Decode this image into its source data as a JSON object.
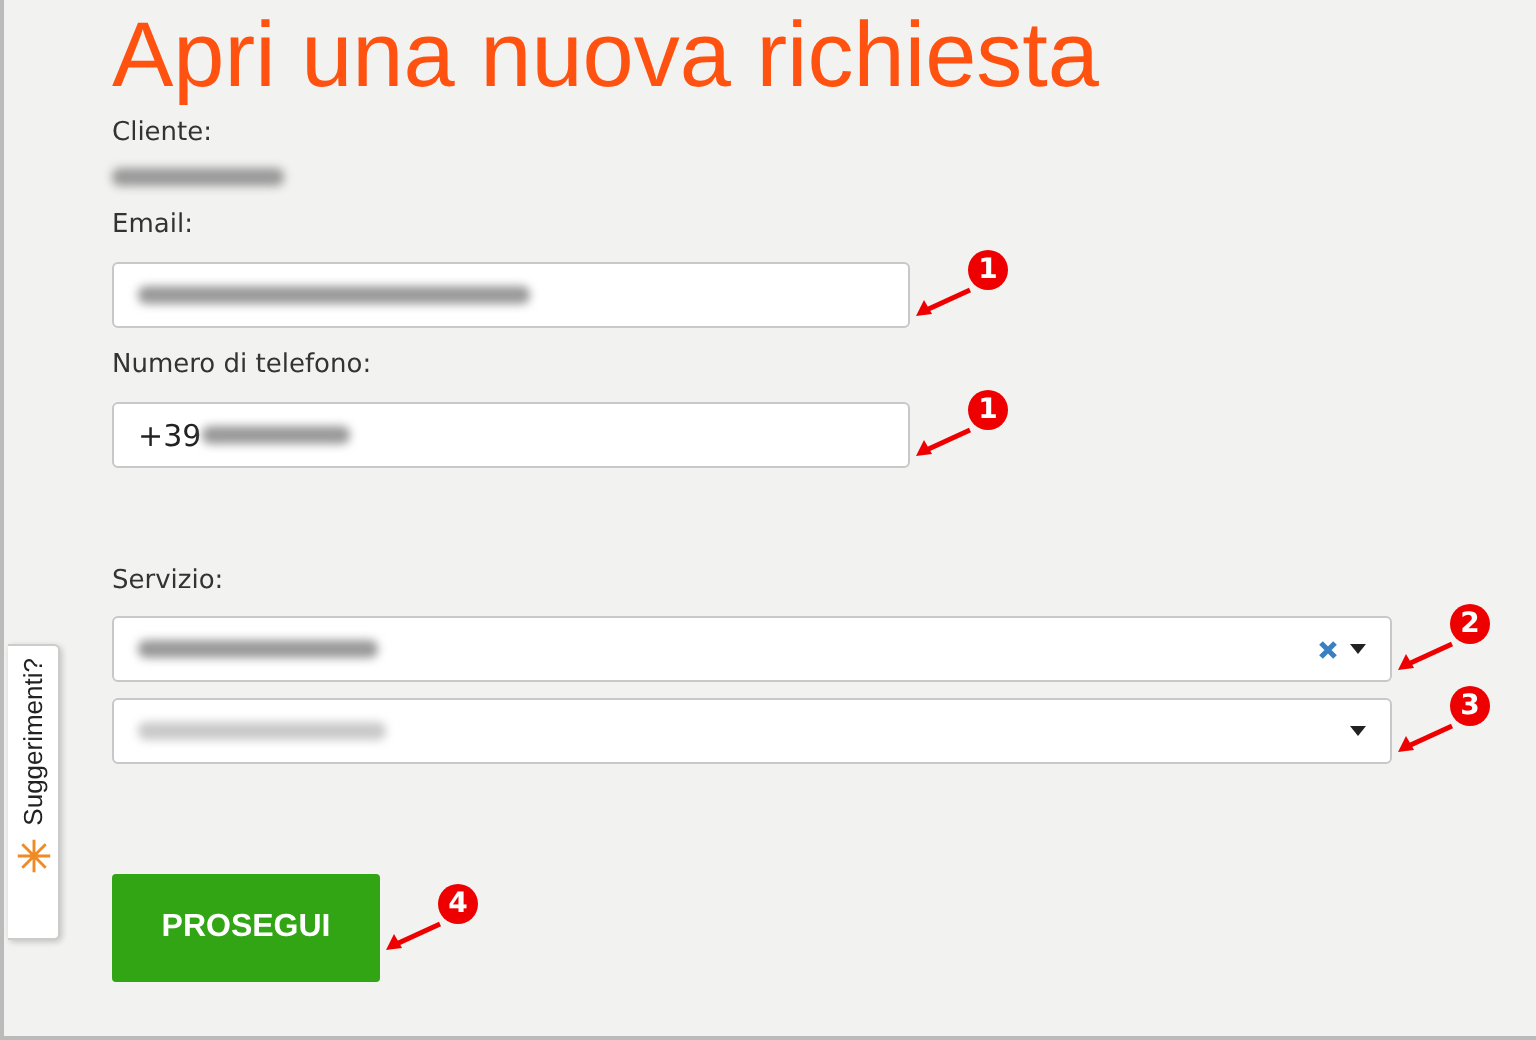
{
  "title": "Apri una nuova richiesta",
  "cliente": {
    "label": "Cliente:"
  },
  "email": {
    "label": "Email:",
    "callout": "1"
  },
  "phone": {
    "label": "Numero di telefono:",
    "prefix": "+39",
    "callout": "1"
  },
  "service": {
    "label": "Servizio:",
    "selects": [
      {
        "clearable": true,
        "callout": "2"
      },
      {
        "clearable": false,
        "callout": "3"
      }
    ]
  },
  "button": {
    "label": "PROSEGUI",
    "callout": "4"
  },
  "feedback_tab": {
    "label": "Suggerimenti?"
  }
}
